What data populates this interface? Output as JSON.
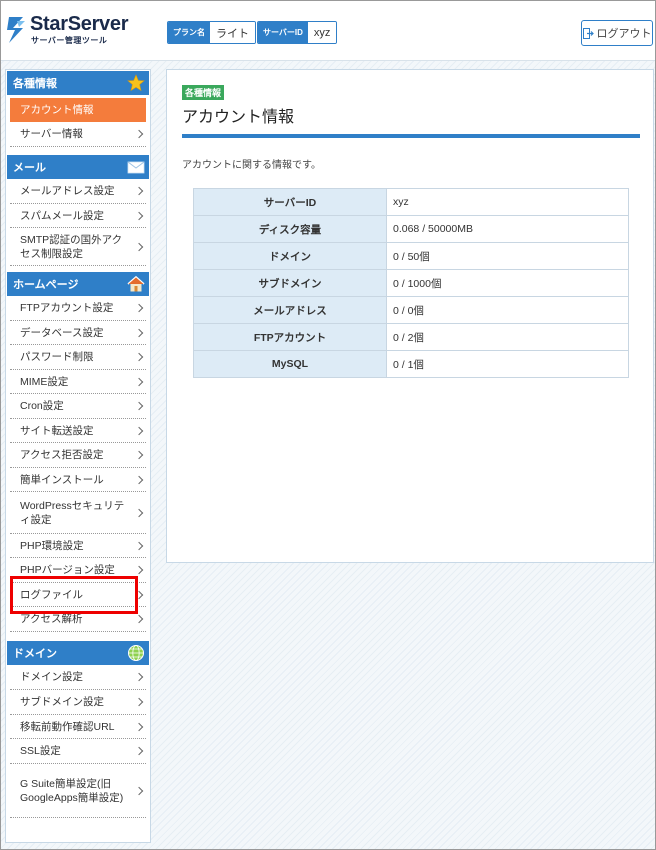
{
  "header": {
    "logo_name": "StarServer",
    "logo_sub": "サーバー管理ツール",
    "plan_tag": "プラン名",
    "plan_value": "ライト",
    "server_tag": "サーバーID",
    "server_value": "xyz",
    "logout_label": "ログアウト"
  },
  "sidebar": {
    "sections": [
      {
        "title": "各種情報",
        "icon": "star-icon",
        "items": [
          "アカウント情報",
          "サーバー情報"
        ]
      },
      {
        "title": "メール",
        "icon": "mail-icon",
        "items": [
          "メールアドレス設定",
          "スパムメール設定",
          "SMTP認証の国外アクセス制限設定"
        ]
      },
      {
        "title": "ホームページ",
        "icon": "house-icon",
        "items": [
          "FTPアカウント設定",
          "データベース設定",
          "パスワード制限",
          "MIME設定",
          "Cron設定",
          "サイト転送設定",
          "アクセス拒否設定",
          "簡単インストール",
          "WordPressセキュリティ設定",
          "PHP環境設定",
          "PHPバージョン設定",
          "ログファイル",
          "アクセス解析"
        ]
      },
      {
        "title": "ドメイン",
        "icon": "globe-icon",
        "items": [
          "ドメイン設定",
          "サブドメイン設定",
          "移転前動作確認URL",
          "SSL設定",
          "G Suite簡単設定(旧GoogleApps簡単設定)"
        ]
      }
    ],
    "active_item": "アカウント情報"
  },
  "main": {
    "badge": "各種情報",
    "title": "アカウント情報",
    "description": "アカウントに関する情報です。",
    "rows": [
      {
        "label": "サーバーID",
        "value": "xyz"
      },
      {
        "label": "ディスク容量",
        "value": "0.068 / 50000MB"
      },
      {
        "label": "ドメイン",
        "value": "0 / 50個"
      },
      {
        "label": "サブドメイン",
        "value": "0 / 1000個"
      },
      {
        "label": "メールアドレス",
        "value": "0 / 0個"
      },
      {
        "label": "FTPアカウント",
        "value": "0 / 2個"
      },
      {
        "label": "MySQL",
        "value": "0 / 1個"
      }
    ]
  },
  "colors": {
    "accent": "#2f7fc8",
    "active": "#f47c3c",
    "badge": "#3aa85c",
    "highlight": "#ee0000"
  }
}
